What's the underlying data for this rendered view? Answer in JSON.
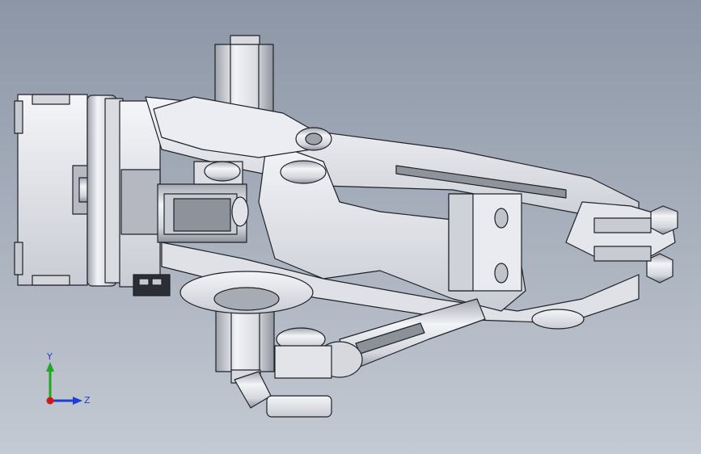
{
  "viewport": {
    "background_top": "#8c96a6",
    "background_bottom": "#c4cad3"
  },
  "model": {
    "part_fill": "#e6e8ee",
    "part_shade": "#b9bdc7",
    "part_dark": "#7e828c",
    "edge_color": "#1f2228"
  },
  "triad": {
    "x_label": "",
    "y_label": "Y",
    "z_label": "Z",
    "x_color": "#d01818",
    "y_color": "#1fa81f",
    "z_color": "#1a3fd6"
  }
}
